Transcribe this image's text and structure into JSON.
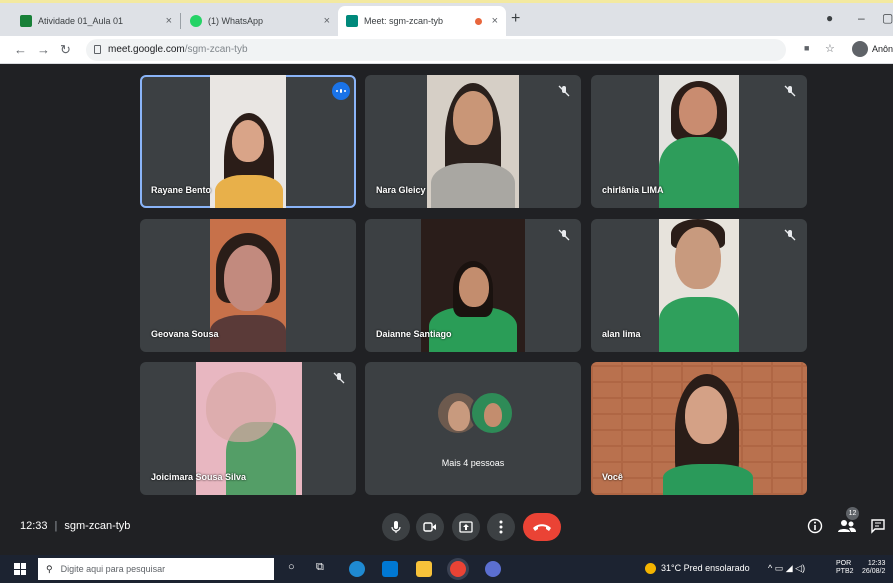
{
  "browser": {
    "tabs": [
      {
        "title": "Atividade 01_Aula 01",
        "close": "×",
        "favicon_color": "#188038"
      },
      {
        "title": "(1) WhatsApp",
        "close": "×",
        "favicon_color": "#25d366"
      },
      {
        "title": "Meet: sgm-zcan-tyb",
        "close": "×",
        "favicon_color": "#00897b"
      }
    ],
    "new_tab": "+",
    "url_host": "meet.google.com",
    "url_path": "/sgm-zcan-tyb",
    "profile_label": "Anôn"
  },
  "participants": [
    {
      "name": "Rayane Bento",
      "mic": "speaking",
      "shirt": "#e8b04a",
      "bg": "#e9e6e3"
    },
    {
      "name": "Nara Gleicy",
      "mic": "muted",
      "shirt": "#a9a7a2",
      "bg": "#d6cfc6"
    },
    {
      "name": "chirlânia LIMA",
      "mic": "muted",
      "shirt": "#2e9d5b",
      "bg": "#e3e2df"
    },
    {
      "name": "Geovana Sousa",
      "mic": "none",
      "shirt": "#5a3a38",
      "bg": "#c7714a"
    },
    {
      "name": "Daianne Santiago",
      "mic": "muted",
      "shirt": "#2a9d57",
      "bg": "#2a1d1a"
    },
    {
      "name": "alan lima",
      "mic": "muted",
      "shirt": "#2fa05c",
      "bg": "#e7e3dc"
    },
    {
      "name": "Joicimara Sousa Silva",
      "mic": "muted",
      "shirt": "#3a9a57",
      "bg": "#e8b7c1"
    },
    {
      "name": "Mais 4 pessoas",
      "mic": "none",
      "shirt": "",
      "bg": "#3c4043"
    },
    {
      "name": "Você",
      "mic": "none",
      "shirt": "#2a9a5a",
      "bg": "#b9714e"
    }
  ],
  "meeting": {
    "time": "12:33",
    "code": "sgm-zcan-tyb",
    "participant_count": "12"
  },
  "colors": {
    "end_call": "#ea4335",
    "active_outline": "#8ab4f8",
    "tile_bg": "#3c4043"
  },
  "taskbar": {
    "search_placeholder": "Digite aqui para pesquisar",
    "weather": "31°C  Pred ensolarado",
    "lang_top": "POR",
    "lang_bottom": "PTB2",
    "clock_time": "12:33",
    "clock_date": "26/08/2"
  }
}
